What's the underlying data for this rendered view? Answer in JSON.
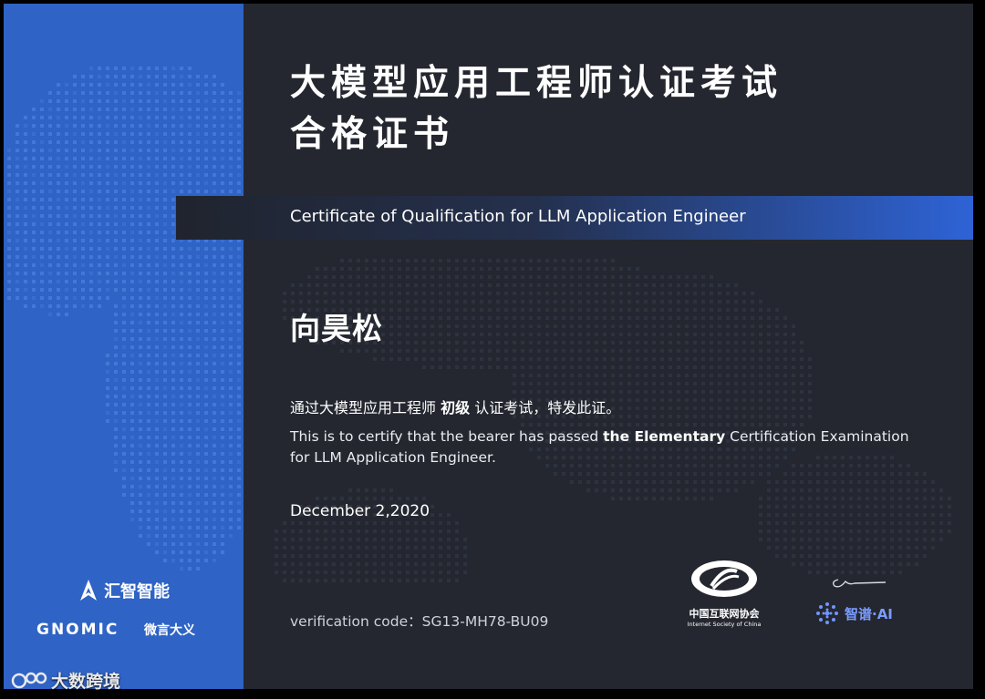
{
  "title": {
    "line1": "大模型应用工程师认证考试",
    "line2": "合格证书"
  },
  "subtitle": "Certificate of Qualification for LLM Application Engineer",
  "holder_name": "向昊松",
  "statement_cn": {
    "before": "通过大模型应用工程师 ",
    "level": "初级",
    "after": " 认证考试，特发此证。"
  },
  "statement_en": {
    "before": "This is to certify that the bearer has passed ",
    "level": "the Elementary",
    "after": " Certification Examination for LLM Application Engineer."
  },
  "date": "December 2,2020",
  "verification": "verification code：SG13-MH78-BU09",
  "logos": {
    "huizhi": "汇智智能",
    "gnomic": "GNOMIC",
    "weiyan": "微言大义",
    "isc_cn": "中国互联网协会",
    "isc_en": "Internet Society of China",
    "zhipu": "智谱·AI"
  },
  "watermark": "大数跨境",
  "colors": {
    "background": "#24272f",
    "side_panel": "#2f63c5",
    "banner_accent": "#2e63d6"
  }
}
